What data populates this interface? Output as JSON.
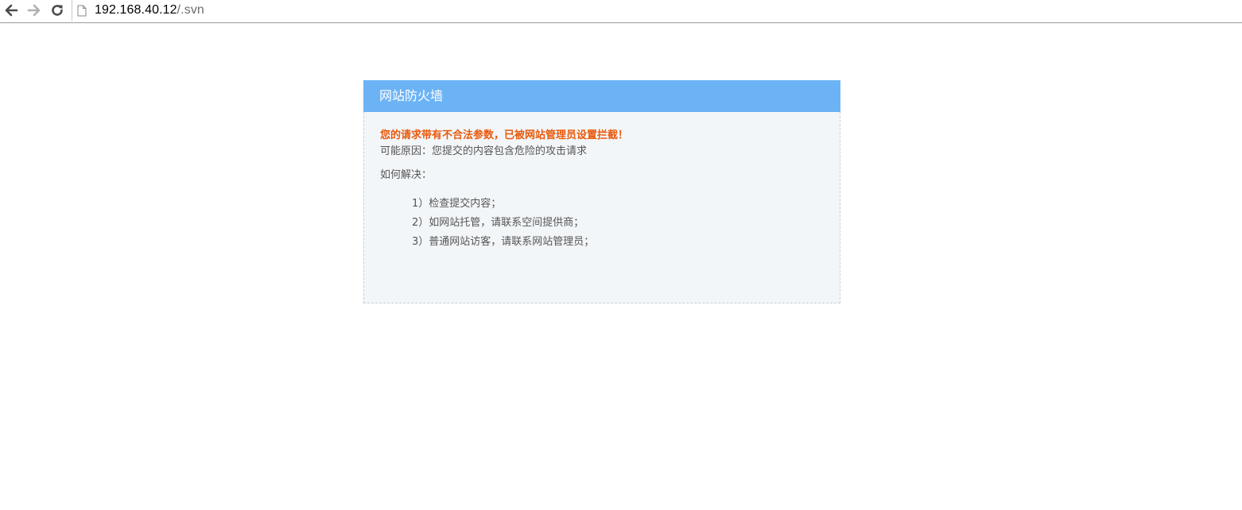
{
  "browser": {
    "url_host": "192.168.40.12",
    "url_path": "/.svn",
    "back_icon": "arrow-left-icon",
    "forward_icon": "arrow-right-icon",
    "reload_icon": "reload-icon",
    "page_icon": "page-icon"
  },
  "firewall": {
    "title": "网站防火墙",
    "alert": "您的请求带有不合法参数，已被网站管理员设置拦截！",
    "reason": "可能原因：您提交的内容包含危险的攻击请求",
    "how_to": "如何解决：",
    "steps": [
      "1）检查提交内容；",
      "2）如网站托管，请联系空间提供商；",
      "3）普通网站访客，请联系网站管理员；"
    ],
    "colors": {
      "header_bg": "#6cb3f5",
      "alert_text": "#e8590c",
      "body_bg": "#f3f6f8"
    }
  }
}
